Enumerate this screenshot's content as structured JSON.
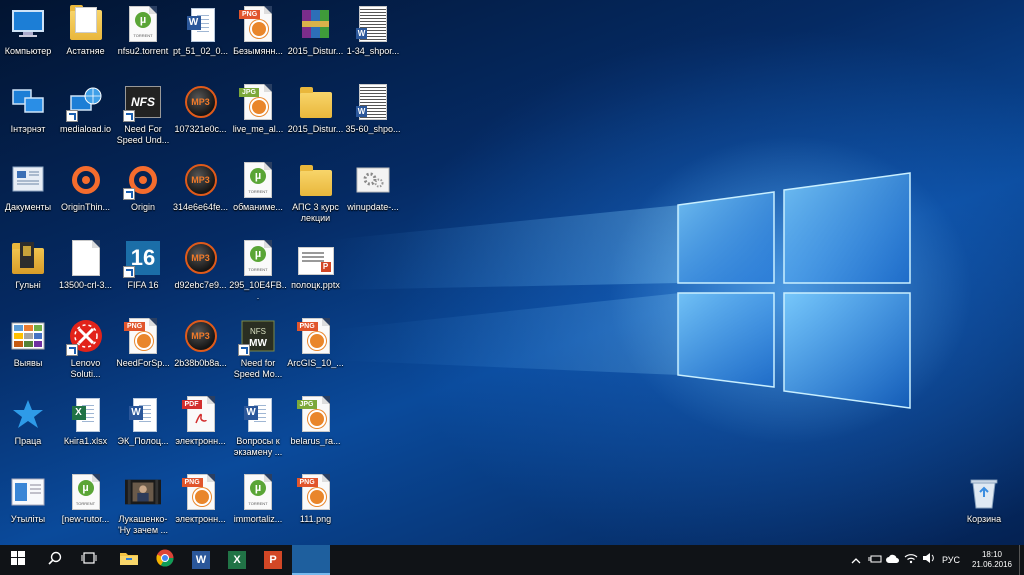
{
  "desktop": {
    "icons": [
      {
        "label": "Компьютер",
        "type": "monitor",
        "shortcut": false
      },
      {
        "label": "Астатняе",
        "type": "folder-doc",
        "shortcut": false
      },
      {
        "label": "nfsu2.torrent",
        "type": "torrent",
        "shortcut": false
      },
      {
        "label": "pt_51_02_0...",
        "type": "word",
        "shortcut": false
      },
      {
        "label": "Безымянн...",
        "type": "png",
        "shortcut": false
      },
      {
        "label": "2015_Distur...",
        "type": "rar",
        "shortcut": false
      },
      {
        "label": "1-34_shpor...",
        "type": "word-scan",
        "shortcut": false
      },
      {
        "label": "Інтэрнэт",
        "type": "network",
        "shortcut": false
      },
      {
        "label": "mediaload.io",
        "type": "globe",
        "shortcut": true
      },
      {
        "label": "Need For Speed Und...",
        "type": "nfs",
        "shortcut": true
      },
      {
        "label": "107321e0c...",
        "type": "mp3",
        "shortcut": false
      },
      {
        "label": "live_me_al...",
        "type": "jpg",
        "shortcut": false
      },
      {
        "label": "2015_Distur...",
        "type": "folder",
        "shortcut": false
      },
      {
        "label": "35-60_shpo...",
        "type": "word-scan",
        "shortcut": false
      },
      {
        "label": "Дакументы",
        "type": "documents",
        "shortcut": false
      },
      {
        "label": "OriginThin...",
        "type": "origin",
        "shortcut": false
      },
      {
        "label": "Origin",
        "type": "origin",
        "shortcut": true
      },
      {
        "label": "314e6e64fe...",
        "type": "mp3",
        "shortcut": false
      },
      {
        "label": "обманиме...",
        "type": "torrent",
        "shortcut": false
      },
      {
        "label": "АПС 3 курс лекции",
        "type": "folder",
        "shortcut": false
      },
      {
        "label": "winupdate-...",
        "type": "settings",
        "shortcut": false
      },
      {
        "label": "Гульні",
        "type": "games",
        "shortcut": false
      },
      {
        "label": "13500-crl-3...",
        "type": "blank",
        "shortcut": false
      },
      {
        "label": "FIFA 16",
        "type": "fifa",
        "shortcut": true
      },
      {
        "label": "d92ebc7e9...",
        "type": "mp3",
        "shortcut": false
      },
      {
        "label": "295_10E4FB...",
        "type": "torrent",
        "shortcut": false
      },
      {
        "label": "полоцк.pptx",
        "type": "pptx-thumb",
        "shortcut": false
      },
      null,
      {
        "label": "Выявы",
        "type": "pictures",
        "shortcut": false
      },
      {
        "label": "Lenovo Soluti...",
        "type": "lenovo",
        "shortcut": true
      },
      {
        "label": "NeedForSp...",
        "type": "png",
        "shortcut": false
      },
      {
        "label": "2b38b0b8a...",
        "type": "mp3",
        "shortcut": false
      },
      {
        "label": "Need for Speed Mo...",
        "type": "nfsmw",
        "shortcut": true
      },
      {
        "label": "ArcGIS_10_...",
        "type": "png",
        "shortcut": false
      },
      null,
      {
        "label": "Праца",
        "type": "star",
        "shortcut": false
      },
      {
        "label": "Кніга1.xlsx",
        "type": "excel",
        "shortcut": false
      },
      {
        "label": "ЭК_Полоц...",
        "type": "word",
        "shortcut": false
      },
      {
        "label": "электронн...",
        "type": "pdf",
        "shortcut": false
      },
      {
        "label": "Вопросы к экзамену ...",
        "type": "word",
        "shortcut": false
      },
      {
        "label": "belarus_ra...",
        "type": "jpg",
        "shortcut": false
      },
      null,
      {
        "label": "Утыліты",
        "type": "utils",
        "shortcut": false
      },
      {
        "label": "[new-rutor...",
        "type": "torrent",
        "shortcut": false
      },
      {
        "label": "Лукашенко-'Ну зачем ...",
        "type": "video",
        "shortcut": false
      },
      {
        "label": "электронн...",
        "type": "png",
        "shortcut": false
      },
      {
        "label": "immortaliz...",
        "type": "torrent",
        "shortcut": false
      },
      {
        "label": "111.png",
        "type": "png",
        "shortcut": false
      },
      null
    ],
    "recycle_bin": {
      "label": "Корзина"
    }
  },
  "file_tags": {
    "png": "PNG",
    "jpg": "JPG",
    "mp3": "MP3",
    "pdf": "PDF",
    "torrent_small": "TORRENT",
    "fifa": "16",
    "nfs": "NFS"
  },
  "taskbar": {
    "start_icon": "windows-logo-icon",
    "search_icon": "search-icon",
    "task_view_icon": "task-view-icon",
    "pinned": [
      {
        "name": "file-explorer",
        "icon": "folder-icon"
      },
      {
        "name": "chrome",
        "icon": "chrome-icon"
      },
      {
        "name": "word",
        "icon": "word-icon",
        "letter": "W"
      },
      {
        "name": "excel",
        "icon": "excel-icon",
        "letter": "X"
      },
      {
        "name": "powerpoint",
        "icon": "powerpoint-icon",
        "letter": "P"
      }
    ],
    "tray": {
      "language": "РУС",
      "time": "18:10",
      "date": "21.06.2016"
    },
    "accent": "#1e90ff",
    "background": "#101317"
  }
}
